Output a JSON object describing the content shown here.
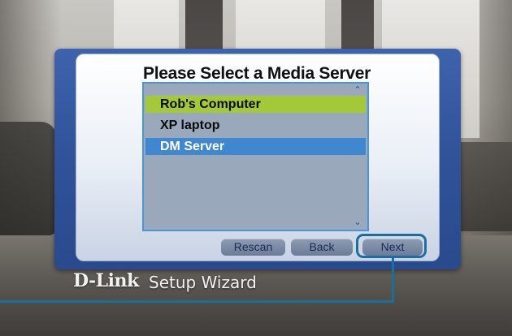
{
  "dialog": {
    "title": "Please Select a Media Server",
    "servers": [
      "Rob's Computer",
      "XP laptop",
      "DM Server"
    ],
    "selected_index": 0,
    "focused_index": 2,
    "scroll_up_icon": "chevron-up-icon",
    "scroll_down_icon": "chevron-down-icon"
  },
  "buttons": {
    "rescan": "Rescan",
    "back": "Back",
    "next": "Next"
  },
  "branding": {
    "logo": "D-Link",
    "subtitle": "Setup Wizard"
  },
  "colors": {
    "frame_blue": "#2f5299",
    "selected_green": "#a3c93a",
    "highlight_blue": "#3f87cf",
    "callout_teal": "#1b6f9c"
  }
}
